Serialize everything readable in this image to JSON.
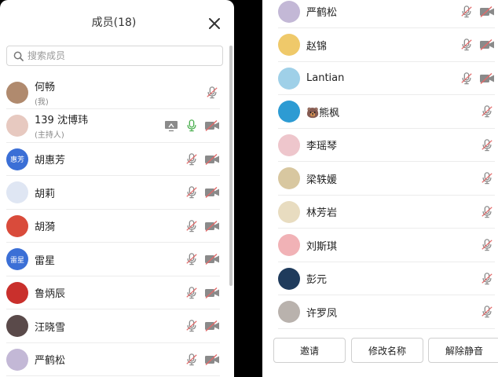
{
  "left_panel": {
    "title": "成员(18)",
    "search_placeholder": "搜索成员",
    "members": [
      {
        "name": "何畅",
        "sub": "(我)",
        "avatar_color": "#b08a6e",
        "avatar_text": "",
        "mic": "muted",
        "video": false,
        "share": false
      },
      {
        "name": "139 沈博玮",
        "sub": "(主持人)",
        "avatar_color": "#e7c9c0",
        "avatar_text": "",
        "mic": "on",
        "video": true,
        "share": true
      },
      {
        "name": "胡惠芳",
        "sub": "",
        "avatar_color": "#3b6fd6",
        "avatar_text": "惠芳",
        "mic": "muted",
        "video": true,
        "share": false
      },
      {
        "name": "胡莉",
        "sub": "",
        "avatar_color": "#dfe6f3",
        "avatar_text": "",
        "mic": "muted",
        "video": true,
        "share": false
      },
      {
        "name": "胡漪",
        "sub": "",
        "avatar_color": "#d94b3b",
        "avatar_text": "",
        "mic": "muted",
        "video": true,
        "share": false
      },
      {
        "name": "雷星",
        "sub": "",
        "avatar_color": "#3b6fd6",
        "avatar_text": "雷星",
        "mic": "muted",
        "video": true,
        "share": false
      },
      {
        "name": "鲁炳辰",
        "sub": "",
        "avatar_color": "#c9302c",
        "avatar_text": "",
        "mic": "muted",
        "video": true,
        "share": false
      },
      {
        "name": "汪晓雪",
        "sub": "",
        "avatar_color": "#5a4a4a",
        "avatar_text": "",
        "mic": "muted",
        "video": true,
        "share": false
      },
      {
        "name": "严鹤松",
        "sub": "",
        "avatar_color": "#c3b8d6",
        "avatar_text": "",
        "mic": "muted",
        "video": true,
        "share": false
      }
    ]
  },
  "right_panel": {
    "members": [
      {
        "name": "严鹤松",
        "avatar_color": "#c3b8d6",
        "mic": "muted",
        "video": true
      },
      {
        "name": "赵锦",
        "avatar_color": "#efc96a",
        "mic": "muted",
        "video": true
      },
      {
        "name": "Lantian",
        "avatar_color": "#9fd0e8",
        "mic": "muted",
        "video": true
      },
      {
        "name": "🐻熊枫",
        "avatar_color": "#2d9bd3",
        "mic": "muted",
        "video": false
      },
      {
        "name": "李瑶琴",
        "avatar_color": "#eec6cc",
        "mic": "muted",
        "video": false
      },
      {
        "name": "梁轶媛",
        "avatar_color": "#d8c7a0",
        "mic": "muted",
        "video": false
      },
      {
        "name": "林芳岩",
        "avatar_color": "#e8dcc0",
        "mic": "muted",
        "video": false
      },
      {
        "name": "刘斯琪",
        "avatar_color": "#f1b2b6",
        "mic": "muted",
        "video": false
      },
      {
        "name": "彭元",
        "avatar_color": "#1f3b5c",
        "mic": "muted",
        "video": false
      },
      {
        "name": "许罗凤",
        "avatar_color": "#b9b2ad",
        "mic": "muted",
        "video": false
      }
    ],
    "buttons": {
      "invite": "邀请",
      "rename": "修改名称",
      "unmute": "解除静音"
    }
  },
  "colors": {
    "muted_red": "#e26a6a",
    "icon_gray": "#8a8a8a",
    "mic_on_green": "#4caf50"
  }
}
